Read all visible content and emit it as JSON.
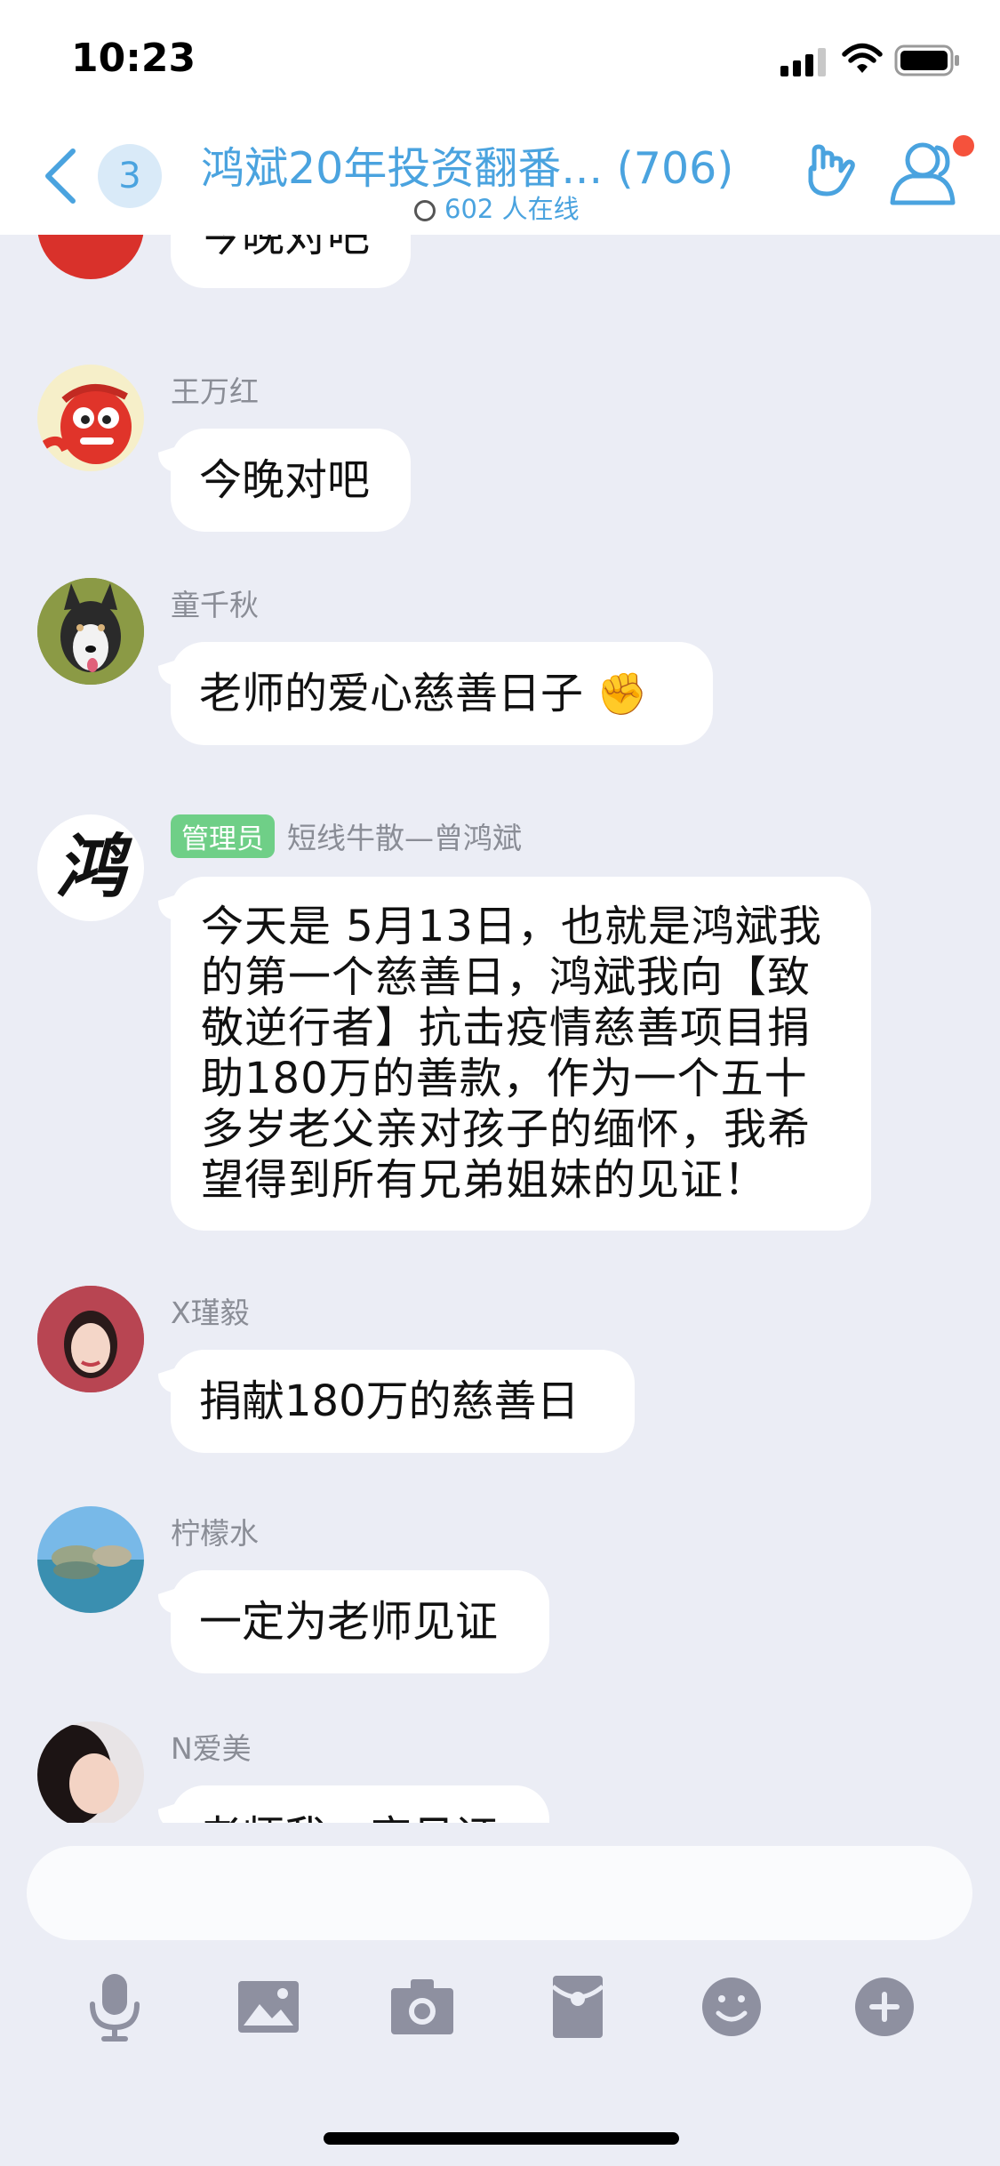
{
  "status_bar": {
    "time": "10:23"
  },
  "header": {
    "badge": "3",
    "title": "鸿斌20年投资翻番...",
    "member_count": "(706)",
    "online": "602 人在线",
    "accent": "#4aa3df"
  },
  "messages": [
    {
      "sender": "",
      "text": "今晚对吧",
      "avatar": "red-mascot-avatar"
    },
    {
      "sender": "王万红",
      "text": "今晚对吧",
      "avatar": "red-mascot-avatar"
    },
    {
      "sender": "童千秋",
      "text": "老师的爱心慈善日子",
      "emoji": "✊",
      "avatar": "dog-avatar"
    },
    {
      "badge": "管理员",
      "sender": "短线牛散—曾鸿斌",
      "avatar_text": "鸿",
      "lines": [
        "今天是 5月13日，也就是鸿斌我",
        "的第一个慈善日，鸿斌我向【致",
        "敬逆行者】抗击疫情慈善项目捐",
        "助180万的善款，作为一个五十",
        "多岁老父亲对孩子的缅怀，我希",
        "望得到所有兄弟姐妹的见证！"
      ]
    },
    {
      "sender": "X瑾毅",
      "text": "捐献180万的慈善日",
      "avatar": "woman-avatar"
    },
    {
      "sender": "柠檬水",
      "text": "一定为老师见证",
      "avatar": "lake-avatar"
    },
    {
      "sender": "N爱美",
      "text": "老师我一定见证",
      "avatar": "woman-avatar-2"
    }
  ],
  "toolbar": {
    "icons": [
      "microphone-icon",
      "image-icon",
      "camera-icon",
      "red-packet-icon",
      "emoji-icon",
      "plus-icon"
    ],
    "icon_color": "#8e90a0"
  }
}
